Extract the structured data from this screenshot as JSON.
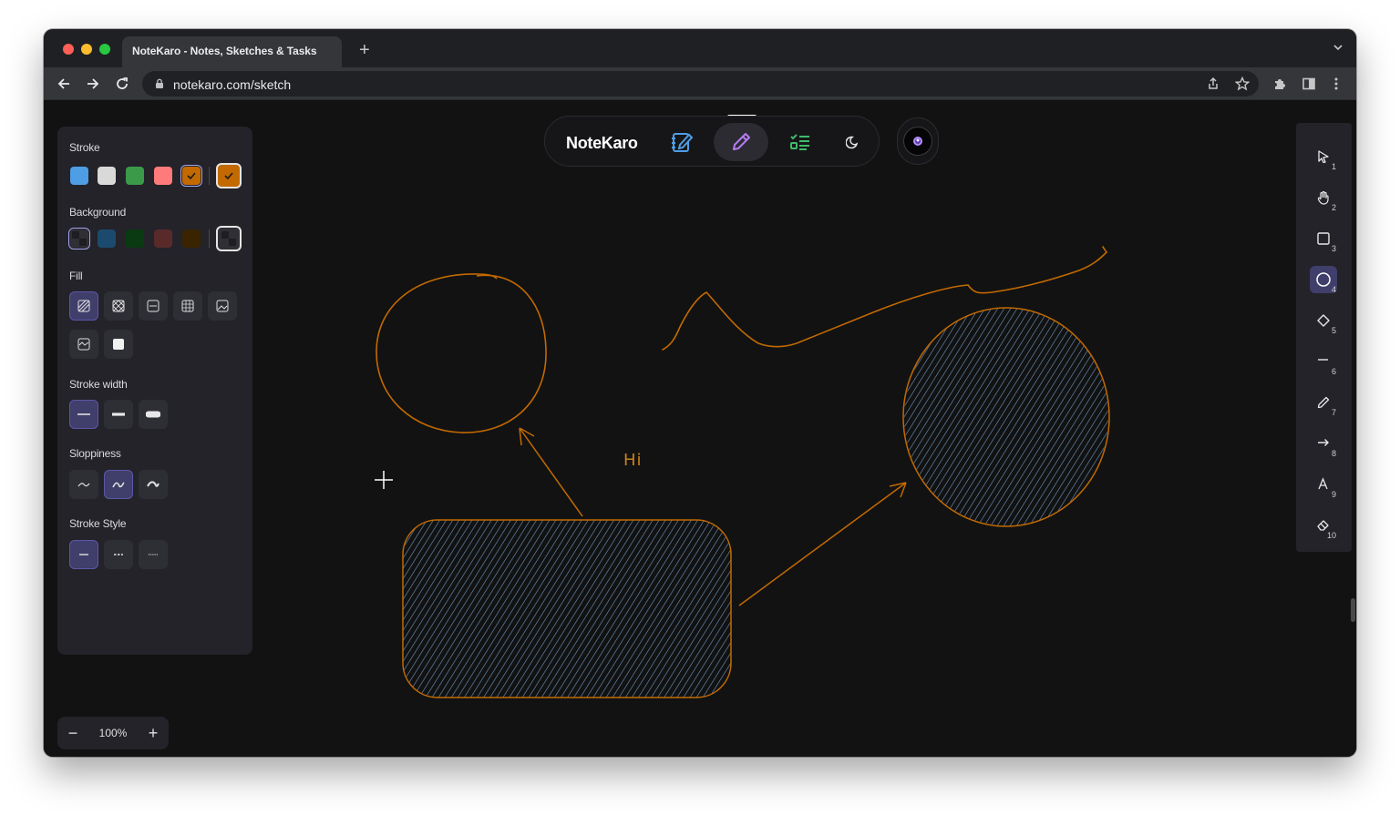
{
  "browser": {
    "tab_title": "NoteKaro - Notes, Sketches & Tasks",
    "url": "notekaro.com/sketch",
    "new_tab_symbol": "+",
    "icons": [
      "back-icon",
      "forward-icon",
      "reload-icon",
      "lock-icon",
      "share-icon",
      "star-icon",
      "extensions-icon",
      "sidebar-icon",
      "kebab-menu-icon",
      "tab-dropdown-icon"
    ]
  },
  "app": {
    "brand": "NoteKaro",
    "nav": [
      {
        "name": "notes",
        "icon": "notebook-pen-icon",
        "active": false
      },
      {
        "name": "sketch",
        "icon": "pencil-icon",
        "active": true
      },
      {
        "name": "tasks",
        "icon": "checklist-icon",
        "active": false
      },
      {
        "name": "theme",
        "icon": "moon-icon",
        "active": false
      }
    ],
    "avatar_icon": "user-avatar-icon"
  },
  "properties": {
    "stroke_label": "Stroke",
    "stroke_colors": [
      "#4e9ee6",
      "#d9d9d9",
      "#3a9a4a",
      "#ff7b7b",
      "#c26a00"
    ],
    "stroke_selected": "#c26a00",
    "background_label": "Background",
    "background_colors": [
      "transparent",
      "#1b4a6e",
      "#0a3a12",
      "#5a2a2a",
      "#3a2400"
    ],
    "background_selected": "transparent",
    "fill_label": "Fill",
    "fill_options": [
      "hachure",
      "cross-hatch",
      "solid-lines",
      "dots",
      "image",
      "zigzag",
      "solid"
    ],
    "fill_selected": "hachure",
    "stroke_width_label": "Stroke width",
    "stroke_width_options": [
      "thin",
      "bold",
      "extra-bold"
    ],
    "stroke_width_selected": "thin",
    "sloppiness_label": "Sloppiness",
    "sloppiness_options": [
      "architect",
      "artist",
      "cartoonist"
    ],
    "sloppiness_selected": "artist",
    "stroke_style_label": "Stroke Style",
    "stroke_style_options": [
      "solid",
      "dashed",
      "dotted"
    ],
    "stroke_style_selected": "solid"
  },
  "zoom": {
    "value": "100%",
    "minus": "−",
    "plus": "+"
  },
  "tools": [
    {
      "name": "selection",
      "icon": "pointer-icon",
      "key": "1"
    },
    {
      "name": "hand",
      "icon": "hand-icon",
      "key": "2"
    },
    {
      "name": "rectangle",
      "icon": "square-icon",
      "key": "3"
    },
    {
      "name": "ellipse",
      "icon": "circle-icon",
      "key": "4",
      "active": true
    },
    {
      "name": "diamond",
      "icon": "diamond-icon",
      "key": "5"
    },
    {
      "name": "line",
      "icon": "line-icon",
      "key": "6"
    },
    {
      "name": "draw",
      "icon": "pencil-icon",
      "key": "7"
    },
    {
      "name": "arrow",
      "icon": "arrow-icon",
      "key": "8"
    },
    {
      "name": "text",
      "icon": "text-icon",
      "key": "9"
    },
    {
      "name": "eraser",
      "icon": "eraser-icon",
      "key": "10"
    }
  ],
  "canvas": {
    "text_element": "Hi",
    "stroke_color": "#c8811c",
    "hatch_color": "#6f98c4"
  }
}
